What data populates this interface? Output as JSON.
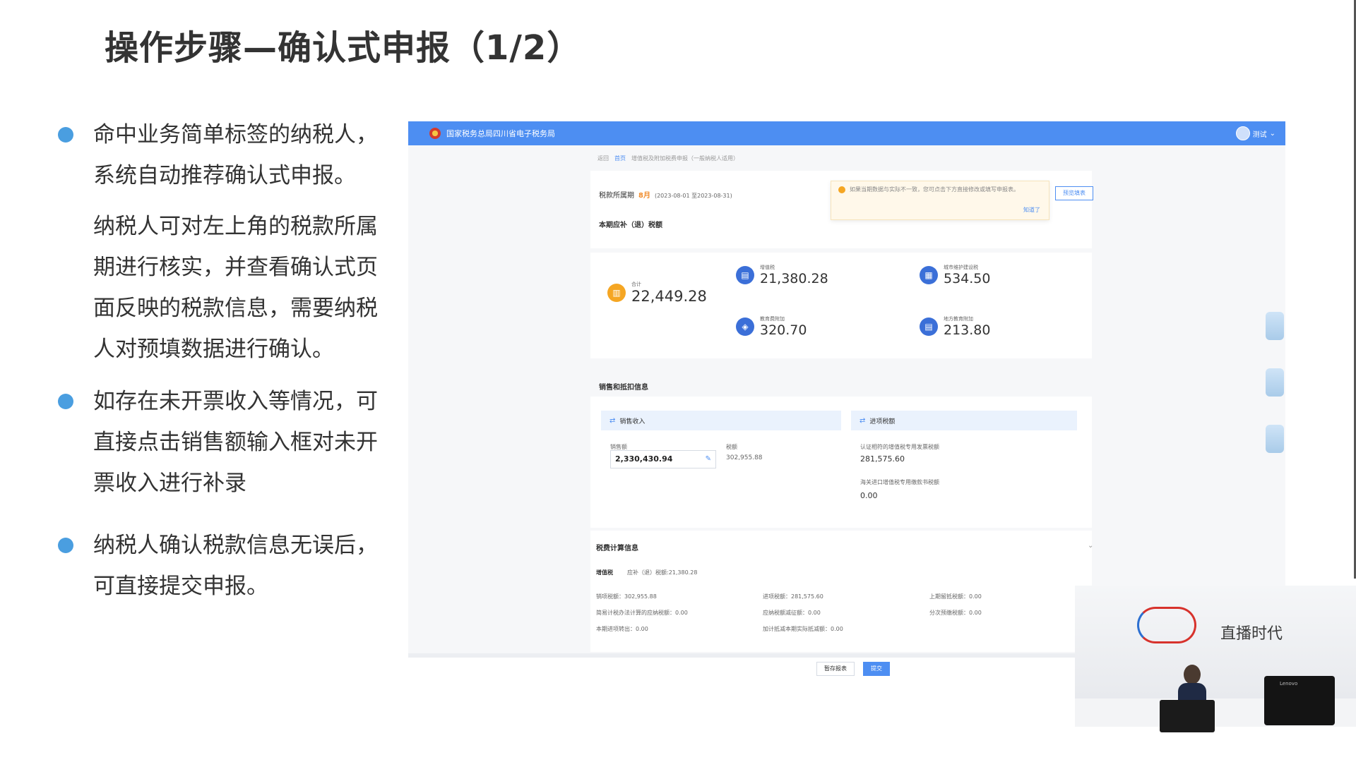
{
  "slide": {
    "title": "操作步骤—确认式申报（1/2）"
  },
  "bullets": {
    "b1": "命中业务简单标签的纳税人，系统自动推荐确认式申报。",
    "b1_sub": "纳税人可对左上角的税款所属期进行核实，并查看确认式页面反映的税款信息，需要纳税人对预填数据进行确认。",
    "b2": "如存在未开票收入等情况，可直接点击销售额输入框对未开票收入进行补录",
    "b3": "纳税人确认税款信息无误后，可直接提交申报。",
    "dot_color": "#4a9ee0"
  },
  "screenshot": {
    "header": {
      "title": "国家税务总局四川省电子税务局",
      "user": "测试",
      "bg_color": "#4d8ef2"
    },
    "breadcrumb": [
      "返回",
      "首页",
      "增值税及附加税费申报（一般纳税人适用）"
    ],
    "period": {
      "label": "税款所属期",
      "month": "8月",
      "range": "(2023-08-01 至2023-08-31)"
    },
    "notice": {
      "text": "如果当期数据与实际不一致，您可点击下方直接修改或填写申报表。",
      "ack": "知道了"
    },
    "preview_button": "预览填表",
    "summary_label": "本期应补（退）税额",
    "kpis": {
      "total": {
        "label": "合计",
        "value": "22,449.28",
        "icon": "bar-chart-icon",
        "color": "#f5a623"
      },
      "vat": {
        "label": "增值税",
        "value": "21,380.28",
        "icon": "invoice-icon",
        "color": "#3b6fd8"
      },
      "urban": {
        "label": "城市维护建设税",
        "value": "534.50",
        "icon": "building-icon",
        "color": "#3b6fd8"
      },
      "edu": {
        "label": "教育费附加",
        "value": "320.70",
        "icon": "graduation-icon",
        "color": "#3b6fd8"
      },
      "local_edu": {
        "label": "地方教育附加",
        "value": "213.80",
        "icon": "ledger-icon",
        "color": "#3b6fd8"
      }
    },
    "sales": {
      "section_label": "销售和抵扣信息",
      "income_head": "销售收入",
      "input_head": "进项税额",
      "sales_amount_label": "销售额",
      "sales_amount_value": "2,330,430.94",
      "tax_label": "税额",
      "tax_value": "302,955.88",
      "certified_label": "认证相符的增值税专用发票税额",
      "certified_value": "281,575.60",
      "customs_label": "海关进口增值税专用缴款书税额",
      "customs_value": "0.00"
    },
    "calc": {
      "section_label": "税费计算信息",
      "vat_tag": "增值税",
      "vat_due": "应补（退）税额:21,380.28",
      "items": [
        "销项税额：302,955.88",
        "进项税额：281,575.60",
        "上期留抵税额：0.00",
        "简易计税办法计算的应纳税额：0.00",
        "应纳税额减征额：0.00",
        "分次预缴税额：0.00",
        "本期进项转出：0.00",
        "加计抵减本期实际抵减额：0.00"
      ]
    },
    "buttons": {
      "save": "暂存报表",
      "submit": "提交"
    }
  },
  "video": {
    "brand": "直播时代",
    "monitor_brand": "Lenovo"
  }
}
